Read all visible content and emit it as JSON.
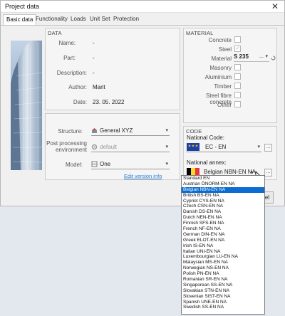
{
  "window": {
    "title": "Project data",
    "close_glyph": "✕"
  },
  "tabs": [
    {
      "label": "Basic data",
      "active": true
    },
    {
      "label": "Functionality"
    },
    {
      "label": "Loads"
    },
    {
      "label": "Unit Set"
    },
    {
      "label": "Protection"
    }
  ],
  "data_group": {
    "title": "DATA",
    "name_label": "Name:",
    "name_value": "-",
    "part_label": "Part:",
    "part_value": "-",
    "description_label": "Description:",
    "description_value": "-",
    "author_label": "Author:",
    "author_value": "Marit",
    "date_label": "Date:",
    "date_value": "23. 05. 2022"
  },
  "structure_group": {
    "structure_label": "Structure:",
    "structure_value": "General XYZ",
    "postprocessing_label": "Post processing environment",
    "postprocessing_value": "default",
    "model_label": "Model:",
    "model_value": "One",
    "link_text": "Edit version info"
  },
  "material_group": {
    "title": "MATERIAL",
    "items": [
      {
        "label": "Concrete",
        "checked": false
      },
      {
        "label": "Steel",
        "checked": true
      },
      {
        "label": "Material",
        "value": "S 235",
        "is_select": true
      },
      {
        "label": "Masonry",
        "checked": false
      },
      {
        "label": "Aluminium",
        "checked": false
      },
      {
        "label": "Timber",
        "checked": false
      },
      {
        "label": "Steel fibre concrete",
        "checked": false
      },
      {
        "label": "Other",
        "checked": false
      }
    ],
    "material_more": "..."
  },
  "code_group": {
    "title": "CODE",
    "national_code_label": "National Code:",
    "national_code_value": "EC - EN",
    "national_annex_label": "National annex:",
    "national_annex_value": "Belgian NBN-EN NA",
    "more_label": "...",
    "colors": {
      "eu_blue": "#1f3fa8",
      "eu_star": "#ffd800",
      "be_black": "#000000",
      "be_yellow": "#fdda24",
      "be_red": "#ef3340"
    }
  },
  "cancel_button": "Cancel",
  "annex_options": {
    "selected_index": 2,
    "items": [
      "Standard EN",
      "Austrian ÖNORM-EN NA",
      "Belgian NBN-EN NA",
      "British BS-EN NA",
      "Cypriot CYS-EN NA",
      "Czech CSN-EN NA",
      "Danish DS-EN NA",
      "Dutch NEN-EN NA",
      "Finnish SFS-EN NA",
      "French NF-EN NA",
      "German DIN-EN NA",
      "Greek ELOT-EN NA",
      "Irish IS-EN NA",
      "Italian UNI-EN NA",
      "Luxembourgian LU-EN NA",
      "Malaysian MS-EN NA",
      "Norwegian NS-EN NA",
      "Polish PN-EN NA",
      "Romanian SR-EN NA",
      "Singaporean SS-EN NA",
      "Slovakian STN-EN NA",
      "Slovenian SIST-EN NA",
      "Spanish UNE-EN NA",
      "Swedish SS-EN NA"
    ]
  },
  "accent_color": "#0b6dd2"
}
